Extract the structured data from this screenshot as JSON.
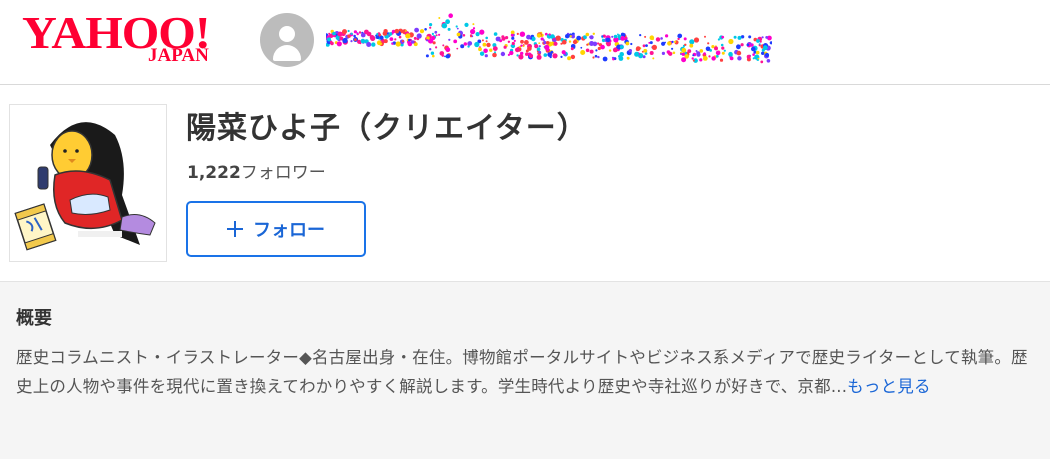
{
  "header": {
    "logo_text": "YAHOO!",
    "logo_sub": "JAPAN"
  },
  "profile": {
    "name": "陽菜ひよ子（クリエイター）",
    "follower_count": "1,222",
    "follower_label": "フォロワー",
    "follow_button_label": "フォロー"
  },
  "overview": {
    "heading": "概要",
    "text": "歴史コラムニスト・イラストレーター◆名古屋出身・在住。博物館ポータルサイトやビジネス系メディアで歴史ライターとして執筆。歴史上の人物や事件を現代に置き換えてわかりやすく解説します。学生時代より歴史や寺社巡りが好きで、京都...",
    "more_label": "もっと見る"
  },
  "colors": {
    "brand_red": "#ff0033",
    "link_blue": "#1a66d6",
    "button_border": "#1a73e8"
  },
  "icons": [
    "user-avatar-icon",
    "plus-icon"
  ]
}
